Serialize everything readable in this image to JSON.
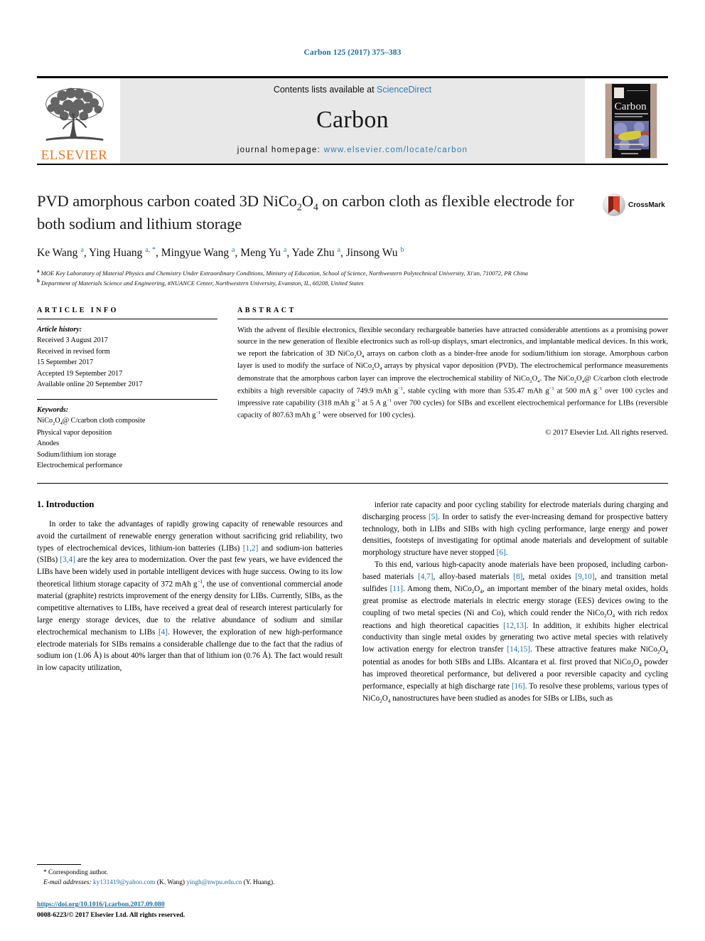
{
  "running_head": "Carbon 125 (2017) 375–383",
  "masthead": {
    "contents_prefix": "Contents lists available at ",
    "contents_link": "ScienceDirect",
    "journal_name": "Carbon",
    "homepage_prefix": "journal homepage: ",
    "homepage_link": "www.elsevier.com/locate/carbon",
    "publisher_logo_text": "ELSEVIER",
    "cover_title": "Carbon"
  },
  "article": {
    "title_line1_a": "PVD amorphous carbon coated 3D NiCo",
    "title_line1_sub1": "2",
    "title_line1_b": "O",
    "title_line1_sub2": "4",
    "title_line1_c": " on carbon cloth as flexible",
    "title_line2": "electrode for both sodium and lithium storage",
    "crossmark_label": "CrossMark",
    "authors_html": "Ke Wang <sup>a</sup>, Ying Huang <sup>a, *</sup>, Mingyue Wang <sup>a</sup>, Meng Yu <sup>a</sup>, Yade Zhu <sup>a</sup>, Jinsong Wu <sup>b</sup>",
    "affiliation_a": "MOE Key Laboratory of Material Physics and Chemistry Under Extraordinary Conditions, Ministry of Education, School of Science, Northwestern Polytechnical University, Xi'an, 710072, PR China",
    "affiliation_b": "Department of Materials Science and Engineering, #NUANCE Center, Northwestern University, Evanston, IL, 60208, United States"
  },
  "info": {
    "heading": "ARTICLE INFO",
    "history_label": "Article history:",
    "history": [
      "Received 3 August 2017",
      "Received in revised form",
      "15 September 2017",
      "Accepted 19 September 2017",
      "Available online 20 September 2017"
    ],
    "keywords_label": "Keywords:",
    "keywords_first_html": "NiCo<sub>2</sub>O<sub>4</sub>@ C/carbon cloth composite",
    "keywords": [
      "Physical vapor deposition",
      "Anodes",
      "Sodium/lithium ion storage",
      "Electrochemical performance"
    ]
  },
  "abstract": {
    "heading": "ABSTRACT",
    "text_html": "With the advent of flexible electronics, flexible secondary rechargeable batteries have attracted considerable attentions as a promising power source in the new generation of flexible electronics such as roll-up displays, smart electronics, and implantable medical devices. In this work, we report the fabrication of 3D NiCo<sub>2</sub>O<sub>4</sub> arrays on carbon cloth as a binder-free anode for sodium/lithium ion storage. Amorphous carbon layer is used to modify the surface of NiCo<sub>2</sub>O<sub>4</sub> arrays by physical vapor deposition (PVD). The electrochemical performance measurements demonstrate that the amorphous carbon layer can improve the electrochemical stability of NiCo<sub>2</sub>O<sub>4</sub>. The NiCo<sub>2</sub>O<sub>4</sub>@ C/carbon cloth electrode exhibits a high reversible capacity of 749.9 mAh g<sup>−1</sup>, stable cycling with more than 535.47 mAh g<sup>−1</sup> at 500 mA g<sup>−1</sup> over 100 cycles and impressive rate capability (318 mAh g<sup>−1</sup> at 5 A g<sup>−1</sup> over 700 cycles) for SIBs and excellent electrochemical performance for LIBs (reversible capacity of 807.63 mAh g<sup>−1</sup> were observed for 100 cycles).",
    "copyright": "© 2017 Elsevier Ltd. All rights reserved."
  },
  "body": {
    "section_heading": "1. Introduction",
    "left_paragraph_html": "In order to take the advantages of rapidly growing capacity of renewable resources and avoid the curtailment of renewable energy generation without sacrificing grid reliability, two types of electrochemical devices, lithium-ion batteries (LIBs) <span class=\"ref\">[1,2]</span> and sodium-ion batteries (SIBs) <span class=\"ref\">[3,4]</span> are the key area to modernization. Over the past few years, we have evidenced the LIBs have been widely used in portable intelligent devices with huge success. Owing to its low theoretical lithium storage capacity of 372 mAh g<sup>−1</sup>, the use of conventional commercial anode material (graphite) restricts improvement of the energy density for LIBs. Currently, SIBs, as the competitive alternatives to LIBs, have received a great deal of research interest particularly for large energy storage devices, due to the relative abundance of sodium and similar electrochemical mechanism to LIBs <span class=\"ref\">[4]</span>. However, the exploration of new high-performance electrode materials for SIBs remains a considerable challenge due to the fact that the radius of sodium ion (1.06 Å) is about 40% larger than that of lithium ion (0.76 Å). The fact would result in low capacity utilization,",
    "right_paragraph1_html": "inferior rate capacity and poor cycling stability for electrode materials during charging and discharging process <span class=\"ref\">[5]</span>. In order to satisfy the ever-increasing demand for prospective battery technology, both in LIBs and SIBs with high cycling performance, large energy and power densities, footsteps of investigating for optimal anode materials and development of suitable morphology structure have never stopped <span class=\"ref\">[6]</span>.",
    "right_paragraph2_html": "To this end, various high-capacity anode materials have been proposed, including carbon-based materials <span class=\"ref\">[4,7]</span>, alloy-based materials <span class=\"ref\">[8]</span>, metal oxides <span class=\"ref\">[9,10]</span>, and transition metal sulfides <span class=\"ref\">[11]</span>. Among them, NiCo<sub>2</sub>O<sub>4</sub>, an important member of the binary metal oxides, holds great promise as electrode materials in electric energy storage (EES) devices owing to the coupling of two metal species (Ni and Co), which could render the NiCo<sub>2</sub>O<sub>4</sub> with rich redox reactions and high theoretical capacities <span class=\"ref\">[12,13]</span>. In addition, it exhibits higher electrical conductivity than single metal oxides by generating two active metal species with relatively low activation energy for electron transfer <span class=\"ref\">[14,15]</span>. These attractive features make NiCo<sub>2</sub>O<sub>4</sub> potential as anodes for both SIBs and LIBs. Alcantara et al. first proved that NiCo<sub>2</sub>O<sub>4</sub> powder has improved theoretical performance, but delivered a poor reversible capacity and cycling performance, especially at high discharge rate <span class=\"ref\">[16]</span>. To resolve these problems, various types of NiCo<sub>2</sub>O<sub>4</sub> nanostructures have been studied as anodes for SIBs or LIBs, such as"
  },
  "footnote": {
    "corresponding": "* Corresponding author.",
    "email_label": "E-mail addresses:",
    "email1": "ky131419@yahoo.com",
    "email1_owner": "(K. Wang)",
    "email2": "yingh@nwpu.edu.cn",
    "email2_owner": "(Y. Huang).",
    "doi": "https://doi.org/10.1016/j.carbon.2017.09.080",
    "issn_line": "0008-6223/© 2017 Elsevier Ltd. All rights reserved."
  },
  "colors": {
    "link": "#1a6fa8",
    "elsevier_orange": "#E87722",
    "masthead_grey": "#e8e8e8"
  }
}
